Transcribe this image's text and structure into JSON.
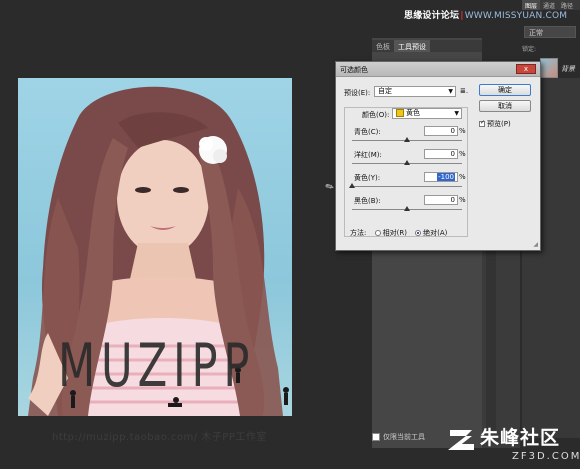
{
  "watermark_top": {
    "text": "思缘设计论坛",
    "sep": "|",
    "url": "WWW.MISSYUAN.COM"
  },
  "ps_tabs": [
    "图层",
    "通道",
    "路径"
  ],
  "ps_side": {
    "mode": "正常",
    "lock": "锁定:",
    "layer_name": "背景"
  },
  "panel_tabs": [
    "色板",
    "工具预设"
  ],
  "panel_footer": {
    "checkbox_label": "仅限当前工具"
  },
  "photo_brand": "MUZIPP",
  "photo_watermark": "http://muzipp.taobao.com/ 木子PP工作室",
  "dialog": {
    "title": "可选颜色",
    "close": "x",
    "preset_label": "预设(E):",
    "preset_value": "自定",
    "preset_icon": "≣.",
    "colors_label": "颜色(O):",
    "colors_value": "黄色",
    "sliders": [
      {
        "label": "青色(C):",
        "value": "0",
        "pct": "%",
        "thumb_pos": 0.5
      },
      {
        "label": "洋红(M):",
        "value": "0",
        "pct": "%",
        "thumb_pos": 0.5
      },
      {
        "label": "黄色(Y):",
        "value": "-100",
        "pct": "%",
        "thumb_pos": 0.0
      },
      {
        "label": "黑色(B):",
        "value": "0",
        "pct": "%",
        "thumb_pos": 0.5
      }
    ],
    "method_label": "方法:",
    "method_relative": "相对(R)",
    "method_absolute": "绝对(A)",
    "ok": "确定",
    "cancel": "取消",
    "preview": "预览(P)"
  },
  "watermark_br": {
    "site": "朱峰社区",
    "domain": "ZF3D.COM"
  },
  "colors": {
    "accent": "#3366cc",
    "close": "#c9463c",
    "yellow_swatch": "#f0c419"
  }
}
